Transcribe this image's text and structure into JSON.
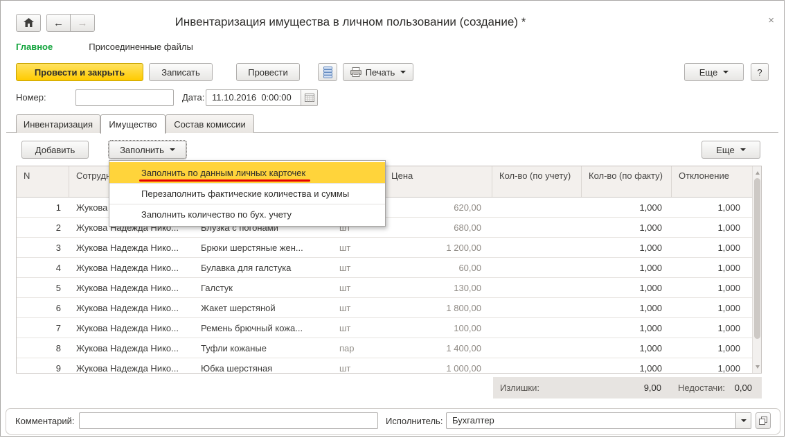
{
  "window": {
    "title": "Инвентаризация имущества в личном пользовании (создание) *",
    "close_glyph": "×",
    "back_glyph": "←",
    "forward_glyph": "→"
  },
  "nav": {
    "main_label": "Главное",
    "attached_files_label": "Присоединенные файлы"
  },
  "toolbar": {
    "post_and_close_label": "Провести и закрыть",
    "write_label": "Записать",
    "post_label": "Провести",
    "print_label": "Печать",
    "more_label": "Еще",
    "help_label": "?"
  },
  "fields": {
    "number_label": "Номер:",
    "number_value": "",
    "date_label": "Дата:",
    "date_value": "11.10.2016  0:00:00"
  },
  "tabs": [
    {
      "label": "Инвентаризация",
      "active": false
    },
    {
      "label": "Имущество",
      "active": true
    },
    {
      "label": "Состав комиссии",
      "active": false
    }
  ],
  "cmdbar": {
    "add_label": "Добавить",
    "fill_label": "Заполнить",
    "more_label": "Еще"
  },
  "fill_menu": {
    "items": [
      {
        "label": "Заполнить по данным личных карточек",
        "highlighted": true,
        "red_underline": true
      },
      {
        "label": "Перезаполнить фактические количества и суммы",
        "highlighted": false,
        "red_underline": false
      },
      {
        "label": "Заполнить количество по бух. учету",
        "highlighted": false,
        "red_underline": false
      }
    ]
  },
  "table": {
    "headers": [
      "N",
      "Сотрудник",
      "",
      "",
      "Цена",
      "Кол-во (по учету)",
      "Кол-во (по факту)",
      "Отклонение"
    ],
    "rows": [
      {
        "n": "1",
        "employee": "Жукова Надежда Нико...",
        "item": "",
        "unit": "",
        "price": "620,00",
        "qty_account": "",
        "qty_fact": "1,000",
        "deviation": "1,000"
      },
      {
        "n": "2",
        "employee": "Жукова Надежда Нико...",
        "item": "Блузка с погонами",
        "unit": "шт",
        "price": "680,00",
        "qty_account": "",
        "qty_fact": "1,000",
        "deviation": "1,000"
      },
      {
        "n": "3",
        "employee": "Жукова Надежда Нико...",
        "item": "Брюки шерстяные жен...",
        "unit": "шт",
        "price": "1 200,00",
        "qty_account": "",
        "qty_fact": "1,000",
        "deviation": "1,000"
      },
      {
        "n": "4",
        "employee": "Жукова Надежда Нико...",
        "item": "Булавка для галстука",
        "unit": "шт",
        "price": "60,00",
        "qty_account": "",
        "qty_fact": "1,000",
        "deviation": "1,000"
      },
      {
        "n": "5",
        "employee": "Жукова Надежда Нико...",
        "item": "Галстук",
        "unit": "шт",
        "price": "130,00",
        "qty_account": "",
        "qty_fact": "1,000",
        "deviation": "1,000"
      },
      {
        "n": "6",
        "employee": "Жукова Надежда Нико...",
        "item": "Жакет шерстяной",
        "unit": "шт",
        "price": "1 800,00",
        "qty_account": "",
        "qty_fact": "1,000",
        "deviation": "1,000"
      },
      {
        "n": "7",
        "employee": "Жукова Надежда Нико...",
        "item": "Ремень брючный кожа...",
        "unit": "шт",
        "price": "100,00",
        "qty_account": "",
        "qty_fact": "1,000",
        "deviation": "1,000"
      },
      {
        "n": "8",
        "employee": "Жукова Надежда Нико...",
        "item": "Туфли кожаные",
        "unit": "пар",
        "price": "1 400,00",
        "qty_account": "",
        "qty_fact": "1,000",
        "deviation": "1,000"
      },
      {
        "n": "9",
        "employee": "Жукова Надежда Нико...",
        "item": "Юбка шерстяная",
        "unit": "шт",
        "price": "1 000,00",
        "qty_account": "",
        "qty_fact": "1,000",
        "deviation": "1,000"
      }
    ]
  },
  "totals": {
    "surplus_label": "Излишки:",
    "surplus_value": "9,00",
    "shortage_label": "Недостачи:",
    "shortage_value": "0,00"
  },
  "footer": {
    "comment_label": "Комментарий:",
    "comment_value": "",
    "executor_label": "Исполнитель:",
    "executor_value": "Бухгалтер"
  },
  "colors": {
    "accent_yellow": "#FFD43B",
    "menu_highlight": "#FFD43B",
    "annotation_red": "#E60000",
    "brand_green": "#12A43C"
  },
  "icons": [
    "home-icon",
    "back-arrow-icon",
    "forward-arrow-icon",
    "register-icon",
    "printer-icon",
    "calendar-icon",
    "caret-down-icon",
    "open-form-icon",
    "close-icon",
    "scroll-up-icon",
    "scroll-down-icon"
  ]
}
